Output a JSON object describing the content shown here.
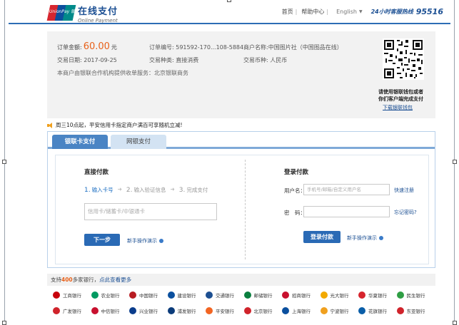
{
  "header": {
    "logo_text": "UnionPay 银联",
    "brand_cn": "在线支付",
    "brand_en": "Online Payment",
    "nav": [
      "首页",
      "帮助中心"
    ],
    "language": "English",
    "hotline_label": "24小时客服热线",
    "hotline_number": "95516"
  },
  "order": {
    "amount_label": "订单金额:",
    "amount_value": "60.00",
    "amount_unit": "元",
    "order_no_label": "订单编号:",
    "order_no_value": "591592-170...108-5884",
    "merchant_label": "商户名称:",
    "merchant_value": "中国图片社（中国图品在线）",
    "date_label": "交易日期:",
    "date_value": "2017-09-25",
    "type_label": "交易种类:",
    "type_value": "直接消费",
    "currency_label": "交易币种:",
    "currency_value": "人民币",
    "org_text": "本商户由银联合作机构提供收单服务：北京银联商务",
    "qr_caption": "请使用银联钱包或者\n你们客户端完成支付",
    "qr_link": "下载银联钱包"
  },
  "promo": {
    "text": "周三10点起，平安信用卡指定商户满百可享随机立减!"
  },
  "tabs": [
    {
      "label": "银联卡支付",
      "active": true
    },
    {
      "label": "网银支付",
      "active": false
    }
  ],
  "direct": {
    "title": "直接付款",
    "steps": [
      {
        "n": "1.",
        "label": "输入卡号",
        "active": true
      },
      {
        "n": "2.",
        "label": "输入验证信息",
        "active": false
      },
      {
        "n": "3.",
        "label": "完成支付",
        "active": false
      }
    ],
    "card_placeholder": "信用卡/储蓄卡/中银通卡",
    "next_button": "下一步",
    "help_text": "新手操作演示"
  },
  "login": {
    "title": "登录付款",
    "username_label": "用户名：",
    "username_placeholder": "手机号/邮箱/自定义用户名",
    "register_link": "快速注册",
    "password_label": "密　码：",
    "forgot_link": "忘记密码?",
    "login_button": "登录付款",
    "help_text": "新手操作演示"
  },
  "banks_section": {
    "prefix": "支持",
    "count": "400",
    "suffix": "多家银行，",
    "more": "点此查看更多",
    "row1": [
      {
        "name": "工商银行",
        "color": "#c7000b"
      },
      {
        "name": "农业银行",
        "color": "#009a61"
      },
      {
        "name": "中国银行",
        "color": "#b81c22"
      },
      {
        "name": "建设银行",
        "color": "#0a4f9e"
      },
      {
        "name": "交通银行",
        "color": "#1d4f91"
      },
      {
        "name": "邮储银行",
        "color": "#0a7f3f"
      },
      {
        "name": "招商银行",
        "color": "#c8102e"
      },
      {
        "name": "光大银行",
        "color": "#f2a900"
      },
      {
        "name": "华夏银行",
        "color": "#d6242d"
      },
      {
        "name": "民生银行",
        "color": "#2f9e44"
      }
    ],
    "row2": [
      {
        "name": "广发银行",
        "color": "#d0232b"
      },
      {
        "name": "中信银行",
        "color": "#c8102e"
      },
      {
        "name": "兴业银行",
        "color": "#0a3c8c"
      },
      {
        "name": "浦发银行",
        "color": "#0b3b7a"
      },
      {
        "name": "平安银行",
        "color": "#f26522"
      },
      {
        "name": "北京银行",
        "color": "#d0232b"
      },
      {
        "name": "上海银行",
        "color": "#0a4f9e"
      },
      {
        "name": "宁波银行",
        "color": "#f0a01e"
      },
      {
        "name": "花旗银行",
        "color": "#0a5ea8"
      },
      {
        "name": "东亚银行",
        "color": "#d0232b"
      }
    ]
  }
}
